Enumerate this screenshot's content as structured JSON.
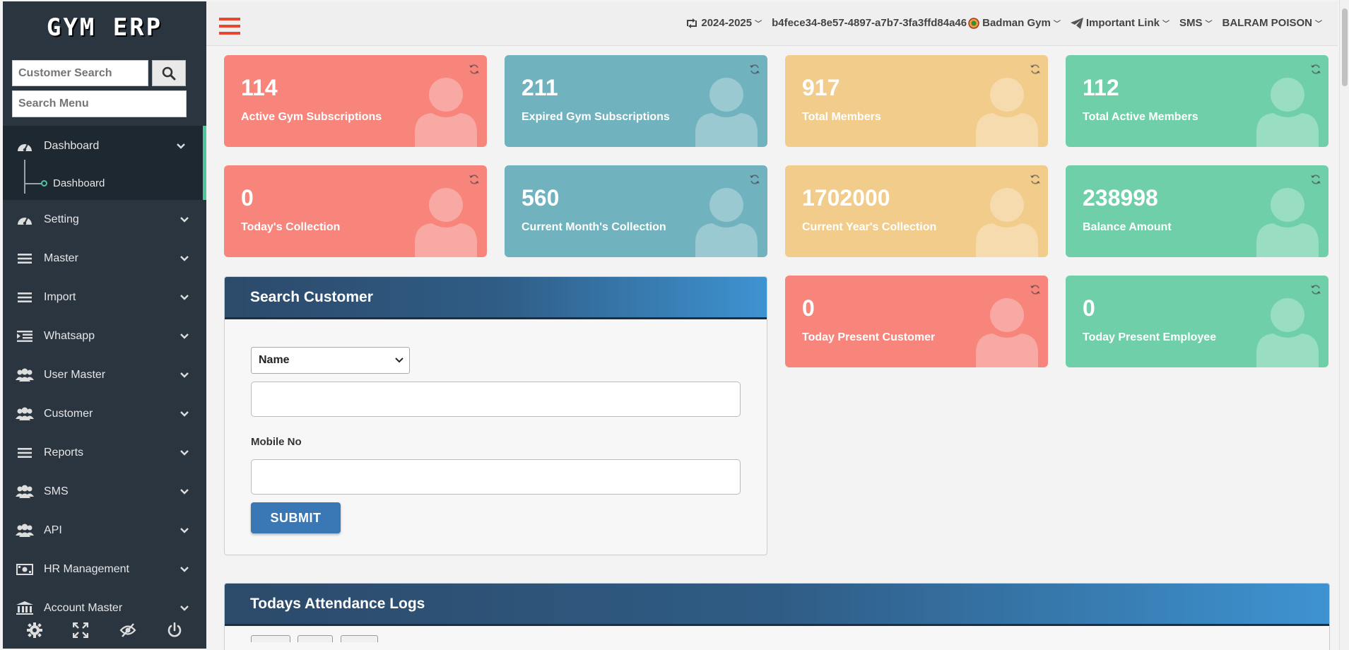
{
  "app": {
    "logo": "GYM ERP"
  },
  "sidebar": {
    "customer_search_placeholder": "Customer Search",
    "menu_search_placeholder": "Search Menu",
    "items": [
      {
        "label": "Dashboard",
        "icon": "dashboard-icon",
        "expanded": true,
        "children": [
          {
            "label": "Dashboard"
          }
        ]
      },
      {
        "label": "Setting",
        "icon": "dashboard-icon"
      },
      {
        "label": "Master",
        "icon": "list-icon"
      },
      {
        "label": "Import",
        "icon": "list-icon"
      },
      {
        "label": "Whatsapp",
        "icon": "indent-list-icon"
      },
      {
        "label": "User Master",
        "icon": "users-icon"
      },
      {
        "label": "Customer",
        "icon": "users-icon"
      },
      {
        "label": "Reports",
        "icon": "list-icon"
      },
      {
        "label": "SMS",
        "icon": "users-icon"
      },
      {
        "label": "API",
        "icon": "users-icon"
      },
      {
        "label": "HR Management",
        "icon": "money-icon"
      },
      {
        "label": "Account Master",
        "icon": "bank-icon"
      }
    ],
    "footer_icons": [
      "gear-icon",
      "fullscreen-icon",
      "eye-slash-icon",
      "power-icon"
    ]
  },
  "topbar": {
    "year": "2024-2025",
    "session_id": "b4fece34-8e57-4897-a7b7-3fa3ffd84a46",
    "gym": "Badman Gym",
    "important_link": "Important Link",
    "sms": "SMS",
    "user": "BALRAM POISON"
  },
  "stats": [
    {
      "value": "114",
      "label": "Active Gym Subscriptions",
      "color": "red"
    },
    {
      "value": "211",
      "label": "Expired Gym Subscriptions",
      "color": "teal"
    },
    {
      "value": "917",
      "label": "Total Members",
      "color": "yellow"
    },
    {
      "value": "112",
      "label": "Total Active Members",
      "color": "green"
    },
    {
      "value": "0",
      "label": "Today's Collection",
      "color": "red"
    },
    {
      "value": "560",
      "label": "Current Month's Collection",
      "color": "teal"
    },
    {
      "value": "1702000",
      "label": "Current Year's Collection",
      "color": "yellow"
    },
    {
      "value": "238998",
      "label": "Balance Amount",
      "color": "green"
    },
    {
      "value": "0",
      "label": "Today Present Customer",
      "color": "red"
    },
    {
      "value": "0",
      "label": "Today Present Employee",
      "color": "green"
    }
  ],
  "search_customer": {
    "title": "Search Customer",
    "select_value": "Name",
    "mobile_label": "Mobile No",
    "submit": "SUBMIT"
  },
  "attendance": {
    "title": "Todays Attendance Logs"
  },
  "colors": {
    "sidebar_bg": "#2a3540",
    "accent": "#4ec59d",
    "red": "#f7857b",
    "teal": "#70b2be",
    "yellow": "#f1cc8a",
    "green": "#6ecfa9",
    "hamburger": "#e8462e",
    "button": "#3a78b5"
  }
}
